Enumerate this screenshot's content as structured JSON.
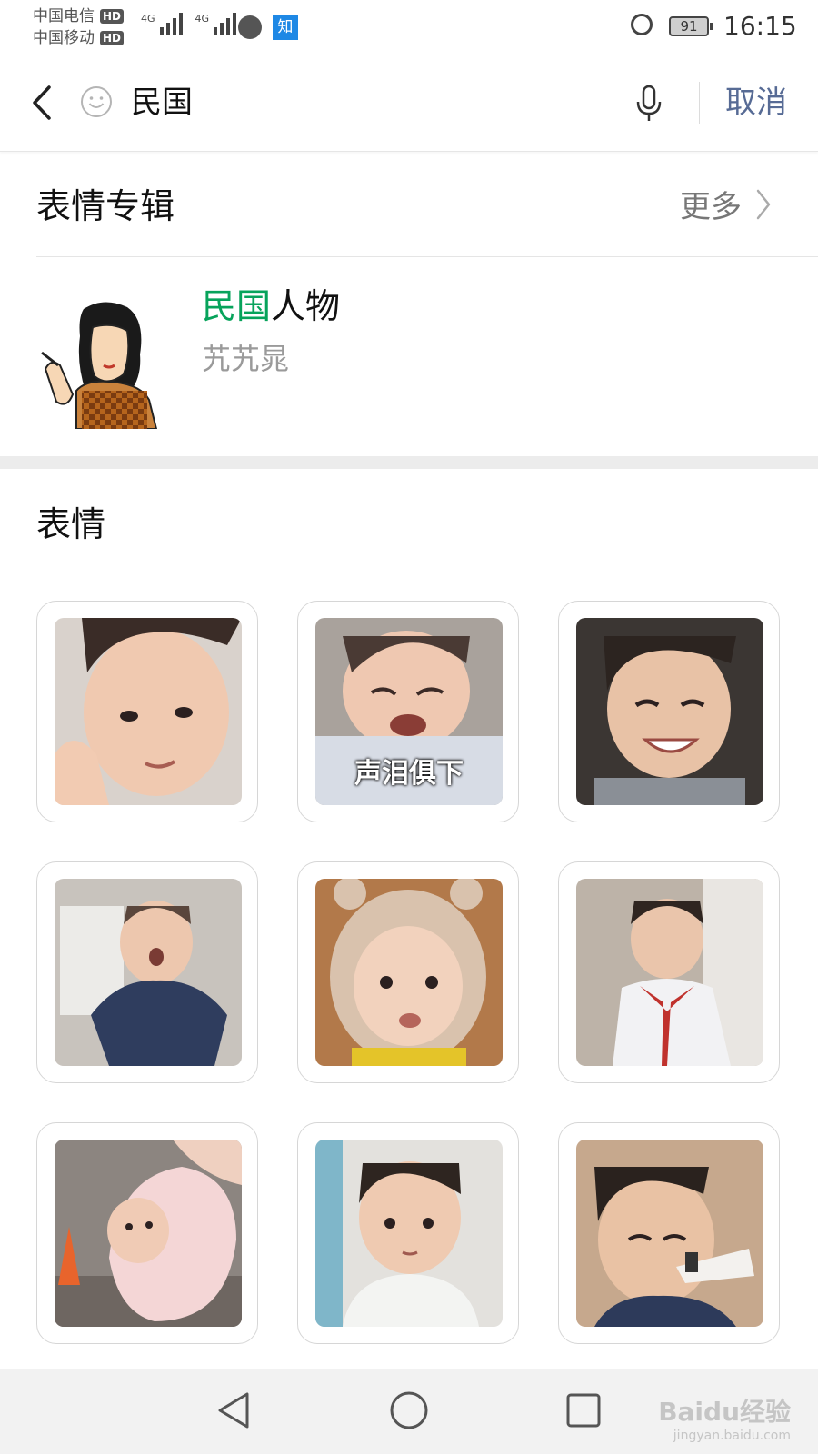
{
  "status_bar": {
    "carrier_1": "中国电信",
    "carrier_2": "中国移动",
    "hd_label": "HD",
    "network_1": "4G",
    "network_2": "4G",
    "app_badge": "知",
    "battery": "91",
    "time": "16:15"
  },
  "search": {
    "query": "民国",
    "cancel_label": "取消"
  },
  "album_section": {
    "title": "表情专辑",
    "more_label": "更多",
    "item": {
      "title_highlight": "民国",
      "title_rest": "人物",
      "author": "艽艽晁"
    }
  },
  "sticker_section": {
    "title": "表情",
    "stickers": [
      {
        "caption": ""
      },
      {
        "caption": "声泪俱下"
      },
      {
        "caption": ""
      },
      {
        "caption": ""
      },
      {
        "caption": ""
      },
      {
        "caption": ""
      },
      {
        "caption": ""
      },
      {
        "caption": ""
      },
      {
        "caption": ""
      }
    ]
  },
  "watermark": {
    "brand": "Baidu经验",
    "url": "jingyan.baidu.com"
  },
  "colors": {
    "accent_green": "#07a35b",
    "link_blue": "#576b95"
  },
  "icons": [
    "back-arrow-icon",
    "smiley-icon",
    "microphone-icon",
    "chevron-right-icon",
    "nav-back-icon",
    "nav-home-icon",
    "nav-recents-icon"
  ]
}
